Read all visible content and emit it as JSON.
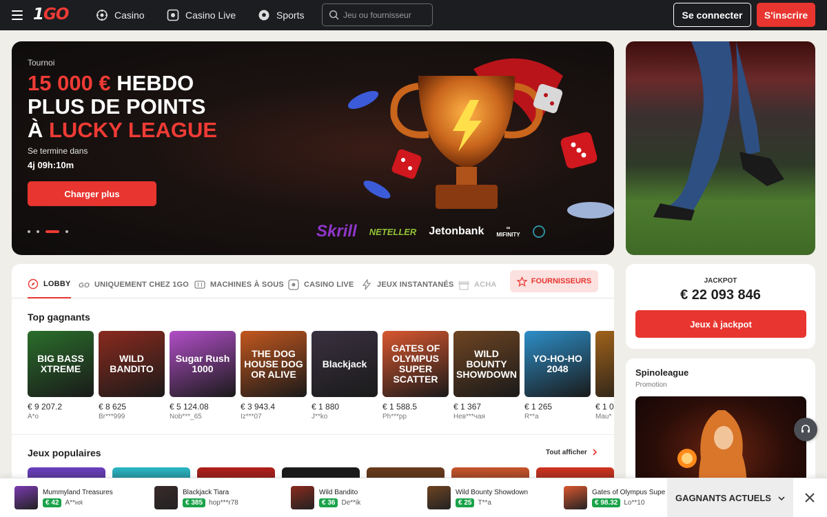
{
  "header": {
    "logo_prefix": "1",
    "logo_suffix": "GO",
    "nav": [
      {
        "label": "Casino",
        "icon": "roulette-icon"
      },
      {
        "label": "Casino Live",
        "icon": "live-tv-icon"
      },
      {
        "label": "Sports",
        "icon": "soccer-ball-icon"
      }
    ],
    "search_placeholder": "Jeu ou fournisseur",
    "login_label": "Se connecter",
    "signup_label": "S'inscrire"
  },
  "hero": {
    "kicker": "Tournoi",
    "title_red_1": "15 000 €",
    "title_white_1": " HEBDO",
    "title_line_2": "PLUS DE POINTS",
    "title_white_3": "À ",
    "title_red_3": "LUCKY LEAGUE",
    "ends_label": "Se termine dans",
    "timer": "4j 09h:10m",
    "button_label": "Charger plus",
    "slide_count": 4,
    "active_slide": 3,
    "payment_logos": [
      "Skrill",
      "NETELLER",
      "Jetonbank",
      "MIFINITY"
    ]
  },
  "tabs": [
    {
      "label": "LOBBY",
      "icon": "compass-icon",
      "active": true
    },
    {
      "label": "UNIQUEMENT CHEZ 1GO",
      "icon": "go-icon",
      "active": false
    },
    {
      "label": "MACHINES À SOUS",
      "icon": "slot-machine-icon",
      "active": false
    },
    {
      "label": "CASINO LIVE",
      "icon": "live-tv-icon",
      "active": false
    },
    {
      "label": "JEUX INSTANTANÉS",
      "icon": "lightning-icon",
      "active": false
    },
    {
      "label": "ACHA",
      "icon": "gift-icon",
      "active": false
    }
  ],
  "providers_tab": {
    "label": "FOURNISSEURS",
    "icon": "star-icon"
  },
  "top_winners": {
    "title": "Top gagnants",
    "items": [
      {
        "game": "BIG BASS XTREME",
        "amount": "€ 9 207.2",
        "user": "A*o",
        "color": "#2a6e2b"
      },
      {
        "game": "WILD BANDITO",
        "amount": "€ 8 625",
        "user": "Br***999",
        "color": "#8a2a1e"
      },
      {
        "game": "Sugar Rush 1000",
        "amount": "€ 5 124.08",
        "user": "Nob***_65",
        "color": "#b14ec7"
      },
      {
        "game": "THE DOG HOUSE DOG OR ALIVE",
        "amount": "€ 3 943.4",
        "user": "Iz***07",
        "color": "#c2571e"
      },
      {
        "game": "Blackjack",
        "amount": "€ 1 880",
        "user": "J**ko",
        "color": "#3a3140"
      },
      {
        "game": "GATES OF OLYMPUS SUPER SCATTER",
        "amount": "€ 1 588.5",
        "user": "Ph***pp",
        "color": "#d8572f"
      },
      {
        "game": "WILD BOUNTY SHOWDOWN",
        "amount": "€ 1 367",
        "user": "Нев***чая",
        "color": "#6e4422"
      },
      {
        "game": "YO-HO-HO 2048",
        "amount": "€ 1 265",
        "user": "R**a",
        "color": "#2d8ec7"
      },
      {
        "game": "",
        "amount": "€ 1 0",
        "user": "Mau*",
        "color": "#a0621a"
      }
    ]
  },
  "popular": {
    "title": "Jeux populaires",
    "show_all": "Tout afficher",
    "colors": [
      "#6b3fbf",
      "#29b7c6",
      "#b21f1a",
      "#1a1a1a",
      "#6a3a1a",
      "#c8542a",
      "#d0331f"
    ]
  },
  "jackpot": {
    "label": "JACKPOT",
    "value": "€ 22 093 846",
    "button_label": "Jeux à jackpot"
  },
  "promo": {
    "title": "Spinoleague",
    "subtitle": "Promotion"
  },
  "ticker": {
    "items": [
      {
        "game": "Mummyland Treasures",
        "amount": "€ 42",
        "user": "A**ня",
        "color": "#7a3ab0"
      },
      {
        "game": "Blackjack Tiara",
        "amount": "€ 385",
        "user": "hop***r78",
        "color": "#3a2a2a"
      },
      {
        "game": "Wild Bandito",
        "amount": "€ 36",
        "user": "De**ik",
        "color": "#8a2a1e"
      },
      {
        "game": "Wild Bounty Showdown",
        "amount": "€ 25",
        "user": "T**a",
        "color": "#6e4422"
      },
      {
        "game": "Gates of Olympus Supe",
        "amount": "€ 98.32",
        "user": "Lo**10",
        "color": "#d8572f"
      }
    ],
    "current_winners_label": "GAGNANTS ACTUELS"
  }
}
